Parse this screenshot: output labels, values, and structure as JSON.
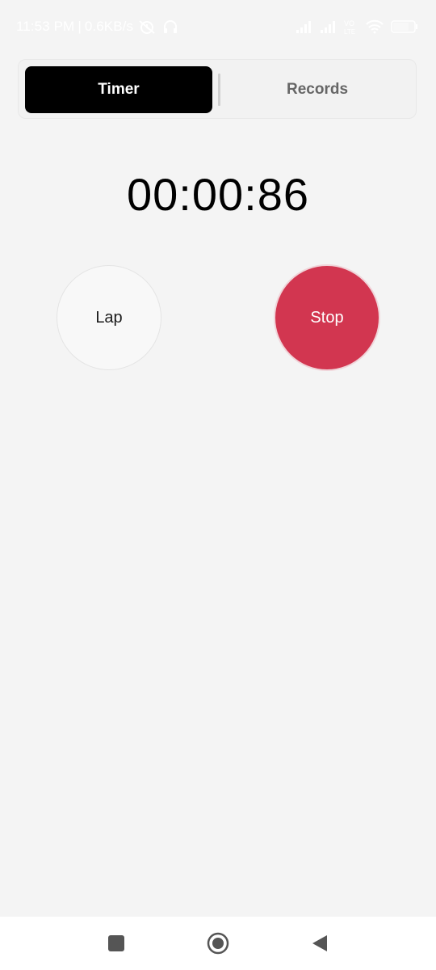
{
  "status_bar": {
    "time": "11:53 PM",
    "separator": "|",
    "network_speed": "0.6KB/s",
    "volte_label": "VO LTE",
    "battery_level": "70"
  },
  "tabs": [
    {
      "label": "Timer",
      "active": true
    },
    {
      "label": "Records",
      "active": false
    }
  ],
  "timer": {
    "display": "00:00:86"
  },
  "buttons": {
    "lap_label": "Lap",
    "stop_label": "Stop"
  },
  "colors": {
    "background": "#f4f4f4",
    "active_tab": "#000000",
    "stop_button": "#d23650"
  },
  "nav_bar": {
    "icons": [
      "recents-square-icon",
      "home-circle-icon",
      "back-triangle-icon"
    ]
  }
}
